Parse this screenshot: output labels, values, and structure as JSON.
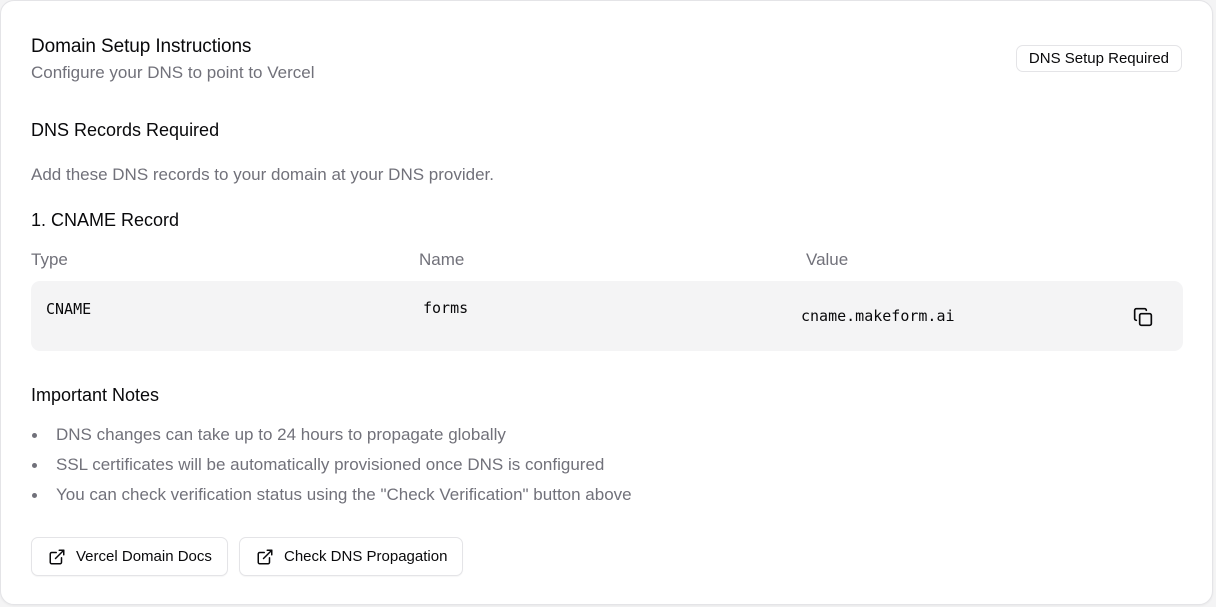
{
  "header": {
    "title": "Domain Setup Instructions",
    "subtitle": "Configure your DNS to point to Vercel",
    "badge": "DNS Setup Required"
  },
  "dns": {
    "section_title": "DNS Records Required",
    "description": "Add these DNS records to your domain at your DNS provider.",
    "record_title": "1. CNAME Record",
    "columns": [
      "Type",
      "Name",
      "Value"
    ],
    "record": {
      "type": "CNAME",
      "name": "forms",
      "value": "cname.makeform.ai"
    },
    "copy_icon": "copy-icon"
  },
  "notes": {
    "title": "Important Notes",
    "items": [
      "DNS changes can take up to 24 hours to propagate globally",
      "SSL certificates will be automatically provisioned once DNS is configured",
      "You can check verification status using the \"Check Verification\" button above"
    ]
  },
  "actions": {
    "vercel_docs": "Vercel Domain Docs",
    "dns_propagation": "Check DNS Propagation",
    "icon": "external-link-icon"
  }
}
